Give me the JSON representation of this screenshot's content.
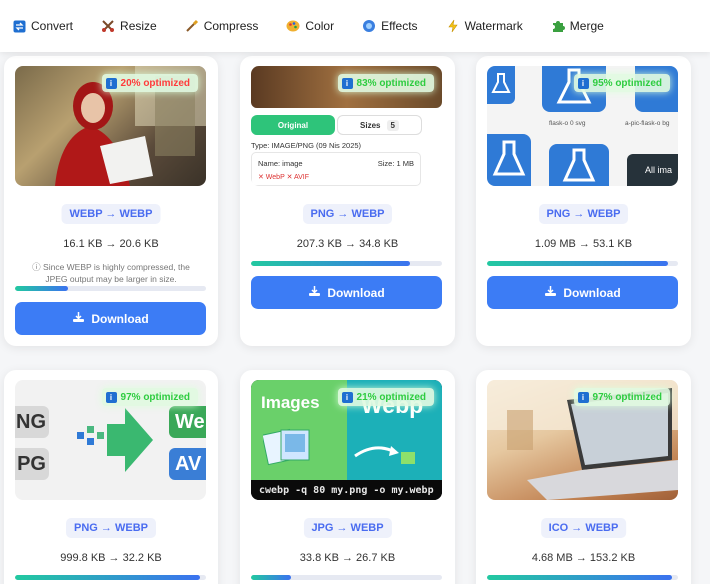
{
  "nav": [
    {
      "label": "Convert",
      "icon": "convert-icon"
    },
    {
      "label": "Resize",
      "icon": "resize-icon"
    },
    {
      "label": "Compress",
      "icon": "compress-icon"
    },
    {
      "label": "Color",
      "icon": "palette-icon"
    },
    {
      "label": "Effects",
      "icon": "effects-icon"
    },
    {
      "label": "Watermark",
      "icon": "lightning-icon"
    },
    {
      "label": "Merge",
      "icon": "puzzle-icon"
    }
  ],
  "colors": {
    "accent": "#3c7cf5",
    "format_text": "#4a6cf0",
    "badge_green": "#2ecc40",
    "badge_red": "#ff3b3b"
  },
  "cards": [
    {
      "badge": "20% optimized",
      "badge_color": "#ff3b3b",
      "format": "WEBP → WEBP",
      "sizes": "16.1 KB → 20.6 KB",
      "progress": 0.28,
      "note": "ⓘ Since WEBP is highly compressed, the JPEG output may be larger in size.",
      "download": "Download"
    },
    {
      "badge": "83% optimized",
      "badge_color": "#2ecc40",
      "format": "PNG → WEBP",
      "sizes": "207.3 KB → 34.8 KB",
      "progress": 0.83,
      "download": "Download",
      "thumb": {
        "tab_original": "Original",
        "tab_sizes": "Sizes",
        "sizes_count": "5",
        "type_line": "Type: IMAGE/PNG (09 Nis 2025)",
        "name_line": "Name: image",
        "size_line": "Size: 1 MB",
        "formats": "✕ WebP  ✕ AVIF"
      }
    },
    {
      "badge": "95% optimized",
      "badge_color": "#2ecc40",
      "format": "PNG → WEBP",
      "sizes": "1.09 MB → 53.1 KB",
      "progress": 0.95,
      "download": "Download",
      "thumb": {
        "caption1": "flask-o 0 svg",
        "caption2": "a-pic-flask-o bg",
        "caption3": "All ima"
      }
    },
    {
      "badge": "97% optimized",
      "badge_color": "#2ecc40",
      "format": "PNG → WEBP",
      "sizes": "999.8 KB → 32.2 KB",
      "progress": 0.97,
      "thumb": {
        "l1": "NG",
        "l2": "PG",
        "r1": "We",
        "r2": "AV"
      }
    },
    {
      "badge": "21% optimized",
      "badge_color": "#2ecc40",
      "format": "JPG → WEBP",
      "sizes": "33.8 KB → 26.7 KB",
      "progress": 0.21,
      "thumb": {
        "left_title": "Images",
        "right_title": "Webp",
        "command": "cwebp -q 80 my.png -o my.webp"
      }
    },
    {
      "badge": "97% optimized",
      "badge_color": "#2ecc40",
      "format": "ICO → WEBP",
      "sizes": "4.68 MB → 153.2 KB",
      "progress": 0.97
    }
  ]
}
